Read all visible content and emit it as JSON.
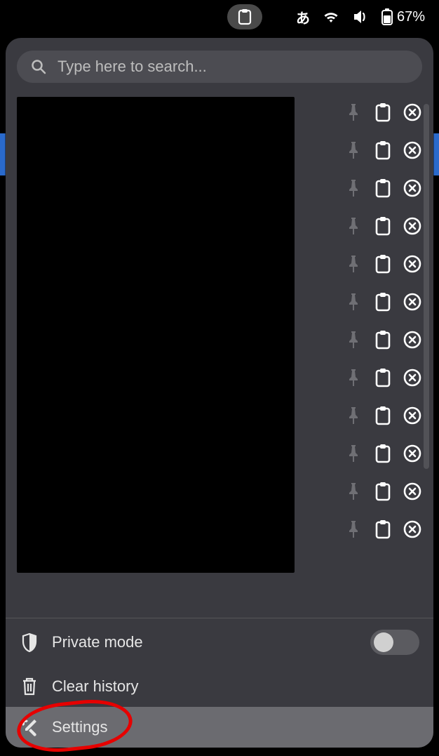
{
  "status_bar": {
    "ime_label": "あ",
    "battery_percent": "67%"
  },
  "search": {
    "placeholder": "Type here to search..."
  },
  "clipboard_rows": [
    {
      "index": 0
    },
    {
      "index": 1
    },
    {
      "index": 2
    },
    {
      "index": 3
    },
    {
      "index": 4
    },
    {
      "index": 5
    },
    {
      "index": 6
    },
    {
      "index": 7
    },
    {
      "index": 8
    },
    {
      "index": 9
    },
    {
      "index": 10
    },
    {
      "index": 11
    }
  ],
  "options": {
    "private_mode": {
      "label": "Private mode",
      "enabled": false
    },
    "clear_history": {
      "label": "Clear history"
    },
    "settings": {
      "label": "Settings",
      "highlighted": true
    }
  }
}
